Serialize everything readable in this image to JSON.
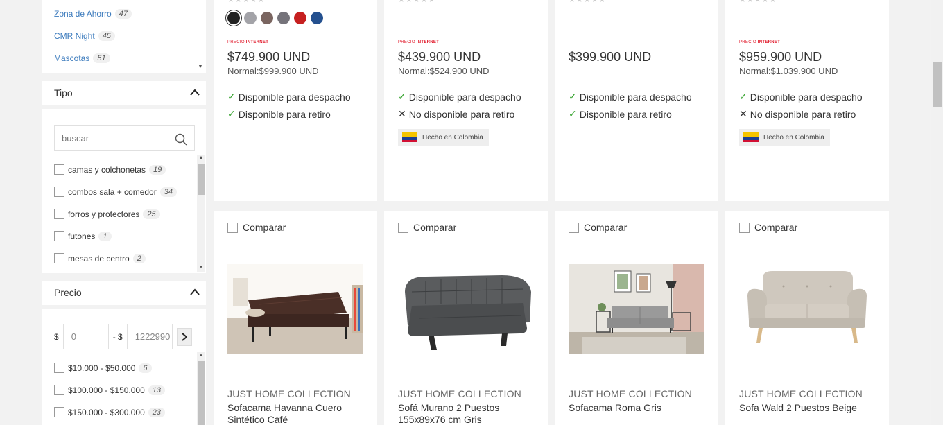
{
  "sidebar": {
    "brand_items": [
      {
        "label": "Zona de Ahorro",
        "count": "47"
      },
      {
        "label": "CMR Night",
        "count": "45"
      },
      {
        "label": "Mascotas",
        "count": "51"
      }
    ],
    "tipo": {
      "title": "Tipo",
      "search_placeholder": "buscar",
      "items": [
        {
          "label": "camas y colchonetas",
          "count": "19"
        },
        {
          "label": "combos sala + comedor",
          "count": "34"
        },
        {
          "label": "forros y protectores",
          "count": "25"
        },
        {
          "label": "futones",
          "count": "1"
        },
        {
          "label": "mesas de centro",
          "count": "2"
        }
      ]
    },
    "precio": {
      "title": "Precio",
      "currency": "$",
      "separator": "- $",
      "min_value": "0",
      "max_value": "1222990",
      "ranges": [
        {
          "label": "$10.000 - $50.000",
          "count": "6"
        },
        {
          "label": "$100.000 - $150.000",
          "count": "13"
        },
        {
          "label": "$150.000 - $300.000",
          "count": "23"
        }
      ]
    }
  },
  "top_cards": [
    {
      "has_swatches": true,
      "swatches": [
        "#222222",
        "#a3a3a8",
        "#7a6560",
        "#75737a",
        "#c62020",
        "#24508f"
      ],
      "badge_precio": "PRECIO",
      "badge_internet": "INTERNET",
      "price": "$749.900 UND",
      "normal": "Normal:$999.900  UND",
      "despacho": {
        "text": "Disponible para despacho",
        "ok": true
      },
      "retiro": {
        "text": "Disponible para retiro",
        "ok": true
      },
      "made_in": ""
    },
    {
      "has_swatches": false,
      "badge_precio": "PRECIO",
      "badge_internet": "INTERNET",
      "price": "$439.900 UND",
      "normal": "Normal:$524.900  UND",
      "despacho": {
        "text": "Disponible para despacho",
        "ok": true
      },
      "retiro": {
        "text": "No disponible para retiro",
        "ok": false
      },
      "made_in": "Hecho en Colombia"
    },
    {
      "has_swatches": false,
      "badge_precio": "",
      "badge_internet": "",
      "price": "$399.900 UND",
      "normal": "",
      "despacho": {
        "text": "Disponible para despacho",
        "ok": true
      },
      "retiro": {
        "text": "Disponible para retiro",
        "ok": true
      },
      "made_in": ""
    },
    {
      "has_swatches": false,
      "badge_precio": "PRECIO",
      "badge_internet": "INTERNET",
      "price": "$959.900 UND",
      "normal": "Normal:$1.039.900  UND",
      "despacho": {
        "text": "Disponible para despacho",
        "ok": true
      },
      "retiro": {
        "text": "No disponible para retiro",
        "ok": false
      },
      "made_in": "Hecho en Colombia"
    }
  ],
  "bottom_cards": [
    {
      "compare_label": "Comparar",
      "brand": "JUST HOME COLLECTION",
      "name": "Sofacama Havanna Cuero Sintético Café"
    },
    {
      "compare_label": "Comparar",
      "brand": "JUST HOME COLLECTION",
      "name": "Sofá Murano 2 Puestos 155x89x76 cm Gris"
    },
    {
      "compare_label": "Comparar",
      "brand": "JUST HOME COLLECTION",
      "name": "Sofacama Roma Gris"
    },
    {
      "compare_label": "Comparar",
      "brand": "JUST HOME COLLECTION",
      "name": "Sofa Wald 2 Puestos Beige"
    }
  ],
  "stars": "★★★★★",
  "icons": {
    "check": "✓",
    "cross": "✕",
    "chevron_up": "chevron-up-icon",
    "search": "search-icon",
    "arrow_right": "chevron-right-icon"
  },
  "colors": {
    "link": "#3c7bbd",
    "badge_red": "#e11a2b",
    "check_green": "#36a32e"
  }
}
